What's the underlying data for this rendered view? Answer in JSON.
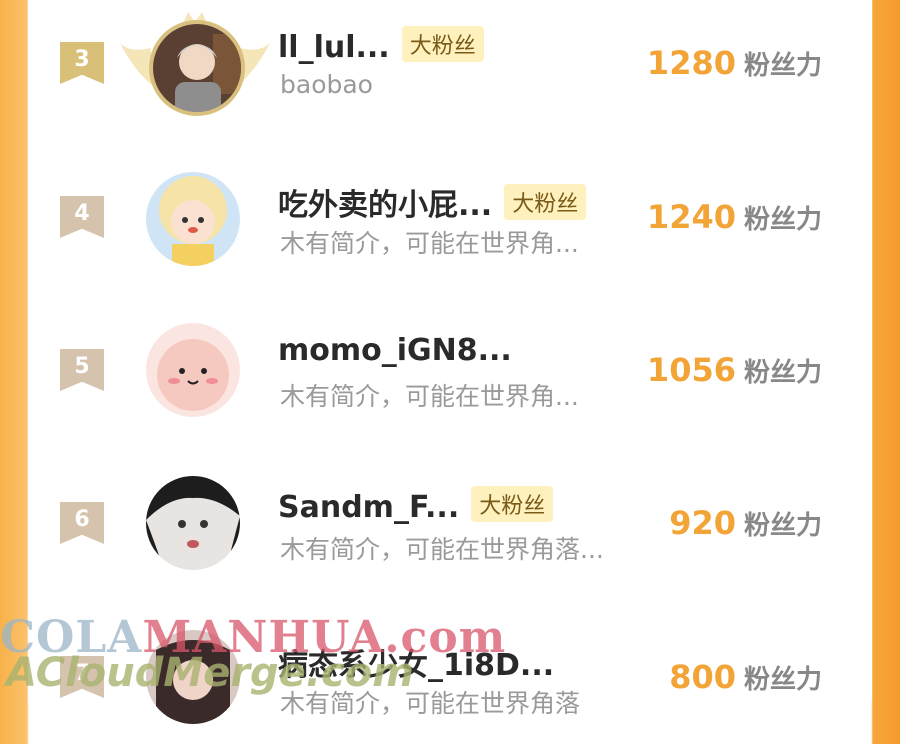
{
  "leaderboard": {
    "rows": [
      {
        "rank": "3",
        "name": "ll_lul...",
        "badge": "大粉丝",
        "bio": "baobao",
        "score": "1280",
        "unit": "粉丝力"
      },
      {
        "rank": "4",
        "name": "吃外卖的小屁...",
        "badge": "大粉丝",
        "bio": "木有简介，可能在世界角...",
        "score": "1240",
        "unit": "粉丝力"
      },
      {
        "rank": "5",
        "name": "momo_iGN8...",
        "badge": "",
        "bio": "木有简介，可能在世界角...",
        "score": "1056",
        "unit": "粉丝力"
      },
      {
        "rank": "6",
        "name": "Sandm_F...",
        "badge": "大粉丝",
        "bio": "木有简介，可能在世界角落...",
        "score": "920",
        "unit": "粉丝力"
      },
      {
        "rank": "7",
        "name": "病态系少女_1i8D...",
        "badge": "",
        "bio": "木有简介，可能在世界角落",
        "score": "800",
        "unit": "粉丝力"
      }
    ]
  },
  "watermark": {
    "line1_a": "COLA",
    "line1_b": "MANHUA.com",
    "line2": "ACloudMerge.com"
  },
  "colors": {
    "score": "#f2a437",
    "badge_bg": "#fff1bd",
    "side_orange": "#f59a2c"
  }
}
